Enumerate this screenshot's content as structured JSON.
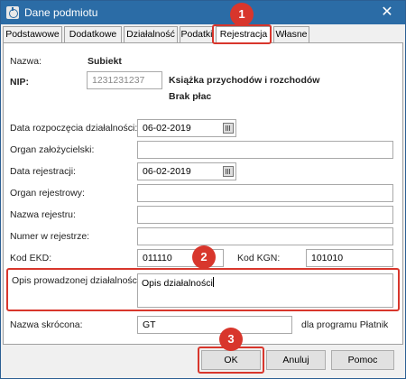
{
  "window": {
    "title": "Dane podmiotu"
  },
  "tabs": [
    {
      "label": "Podstawowe"
    },
    {
      "label": "Dodatkowe"
    },
    {
      "label": "Działalność"
    },
    {
      "label": "Podatki"
    },
    {
      "label": "Rejestracja"
    },
    {
      "label": "Własne"
    }
  ],
  "active_tab": "Rejestracja",
  "header": {
    "nazwa_label": "Nazwa:",
    "nazwa_value": "Subiekt",
    "nip_label": "NIP:",
    "nip_value": "1231231237",
    "info1": "Książka przychodów i rozchodów",
    "info2": "Brak płac"
  },
  "form": {
    "data_rozp_label": "Data rozpoczęcia działalności:",
    "data_rozp_value": "06-02-2019",
    "organ_zal_label": "Organ założycielski:",
    "organ_zal_value": "",
    "data_rej_label": "Data rejestracji:",
    "data_rej_value": "06-02-2019",
    "organ_rej_label": "Organ rejestrowy:",
    "organ_rej_value": "",
    "nazwa_rej_label": "Nazwa rejestru:",
    "nazwa_rej_value": "",
    "numer_rej_label": "Numer w rejestrze:",
    "numer_rej_value": "",
    "kod_ekd_label": "Kod EKD:",
    "kod_ekd_value": "011110",
    "kod_kgn_label": "Kod KGN:",
    "kod_kgn_value": "101010",
    "opis_label": "Opis prowadzonej działalności:",
    "opis_value": "Opis działalności",
    "nazwa_skr_label": "Nazwa skrócona:",
    "nazwa_skr_value": "GT",
    "platnik_note": "dla programu Płatnik"
  },
  "buttons": {
    "ok": "OK",
    "cancel": "Anuluj",
    "help": "Pomoc"
  },
  "annotations": [
    "1",
    "2",
    "3"
  ],
  "colors": {
    "titlebar": "#2b6ca6",
    "highlight": "#d8362c"
  }
}
